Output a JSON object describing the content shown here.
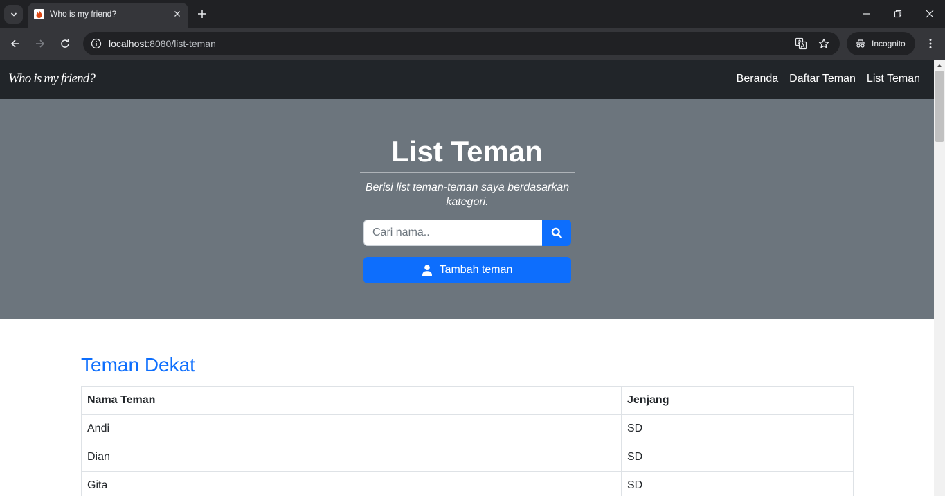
{
  "browser": {
    "tab_title": "Who is my friend?",
    "url_host": "localhost",
    "url_path": ":8080/list-teman",
    "incognito_label": "Incognito",
    "icons": [
      "tab-search-icon",
      "favicon-icon",
      "close-icon",
      "plus-icon",
      "minimize-icon",
      "restore-icon",
      "close-window-icon",
      "back-icon",
      "forward-icon",
      "reload-icon",
      "info-icon",
      "translate-icon",
      "star-icon",
      "incognito-icon",
      "more-icon"
    ]
  },
  "navbar": {
    "brand": "Who is my friend?",
    "links": [
      "Beranda",
      "Daftar Teman",
      "List Teman"
    ]
  },
  "hero": {
    "title": "List Teman",
    "lead": "Berisi list teman-teman saya berdasarkan kategori.",
    "search_placeholder": "Cari nama..",
    "add_button_label": "Tambah teman"
  },
  "section": {
    "title": "Teman Dekat",
    "table": {
      "headers": [
        "Nama Teman",
        "Jenjang"
      ],
      "rows": [
        [
          "Andi",
          "SD"
        ],
        [
          "Dian",
          "SD"
        ],
        [
          "Gita",
          "SD"
        ]
      ]
    }
  },
  "colors": {
    "navbar_bg": "#212529",
    "hero_bg": "#6c757d",
    "primary": "#0d6efd"
  }
}
